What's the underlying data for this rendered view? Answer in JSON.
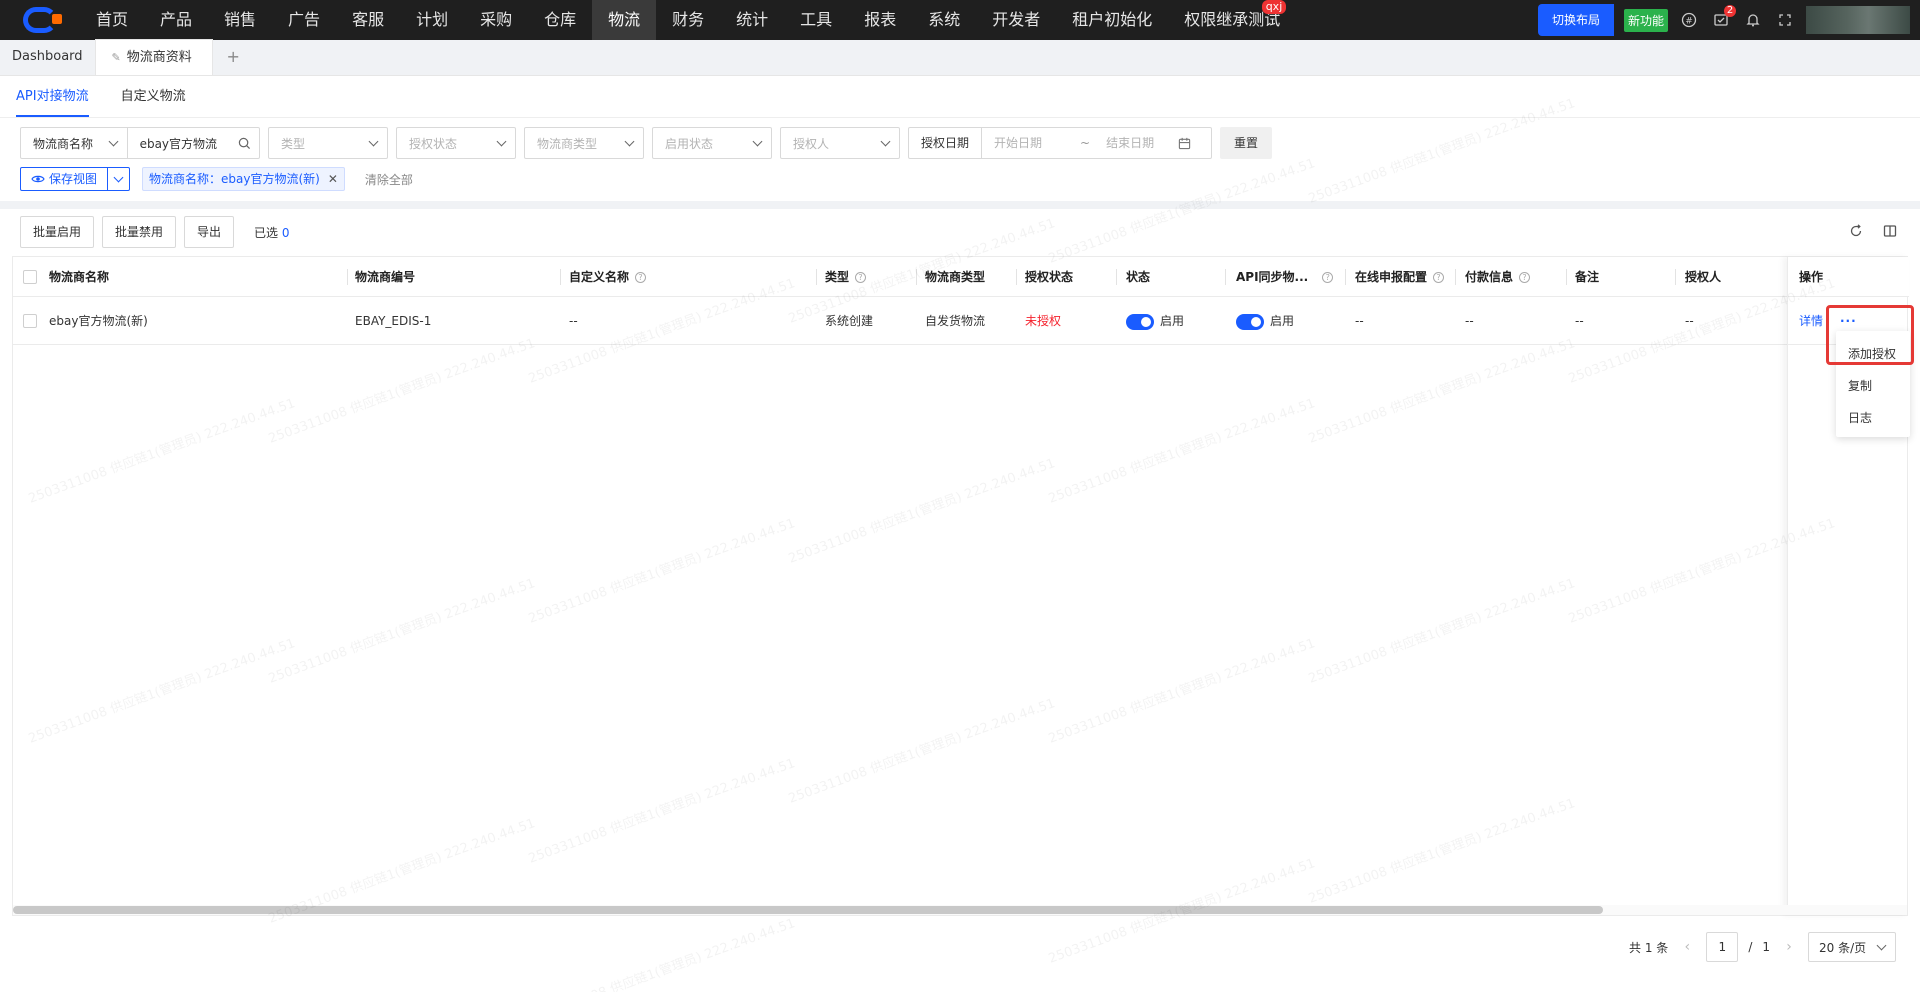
{
  "topnav": {
    "items": [
      "首页",
      "产品",
      "销售",
      "广告",
      "客服",
      "计划",
      "采购",
      "仓库",
      "物流",
      "财务",
      "统计",
      "工具",
      "报表",
      "系统",
      "开发者",
      "租户初始化",
      "权限继承测试"
    ],
    "active_index": 8,
    "badge_text": "qxj",
    "switch_layout": "切换布局",
    "new_feature": "新功能",
    "notification_count": "2"
  },
  "page_tabs": {
    "dashboard": "Dashboard",
    "active": "物流商资料",
    "add": "+"
  },
  "subtabs": [
    "API对接物流",
    "自定义物流"
  ],
  "filters": {
    "field_select": "物流商名称",
    "field_value": "ebay官方物流",
    "type_placeholder": "类型",
    "auth_status_placeholder": "授权状态",
    "provider_type_placeholder": "物流商类型",
    "enable_status_placeholder": "启用状态",
    "authorizer_placeholder": "授权人",
    "date_label": "授权日期",
    "start_date": "开始日期",
    "date_sep": "~",
    "end_date": "结束日期",
    "reset": "重置"
  },
  "view": {
    "save_view": "保存视图",
    "tag": "物流商名称：ebay官方物流(新)",
    "clear_all": "清除全部"
  },
  "toolbar": {
    "batch_enable": "批量启用",
    "batch_disable": "批量禁用",
    "export": "导出",
    "selected_label": "已选",
    "selected_count": "0"
  },
  "table": {
    "columns": [
      "物流商名称",
      "物流商编号",
      "自定义名称",
      "类型",
      "物流商类型",
      "授权状态",
      "状态",
      "API同步物...",
      "在线申报配置",
      "付款信息",
      "备注",
      "授权人",
      "操作"
    ],
    "rows": [
      {
        "name": "ebay官方物流(新)",
        "code": "EBAY_EDIS-1",
        "custom_name": "--",
        "type": "系统创建",
        "provider_type": "自发货物流",
        "auth_status": "未授权",
        "status": "启用",
        "api_sync": "启用",
        "online_decl": "--",
        "payment": "--",
        "remark": "--",
        "authorizer": "--",
        "detail": "详情",
        "more": "···"
      }
    ]
  },
  "dropdown_menu": [
    "添加授权",
    "复制",
    "日志"
  ],
  "pagination": {
    "total": "共 1 条",
    "current": "1",
    "slash": "/",
    "pages": "1",
    "page_size": "20 条/页"
  },
  "watermark": "2503311008 供应链1(管理员) 222.240.44.51",
  "colors": {
    "primary": "#1a5cff",
    "danger": "#f5222d",
    "nav_bg": "#1f1f1f",
    "success": "#2bb24c"
  }
}
